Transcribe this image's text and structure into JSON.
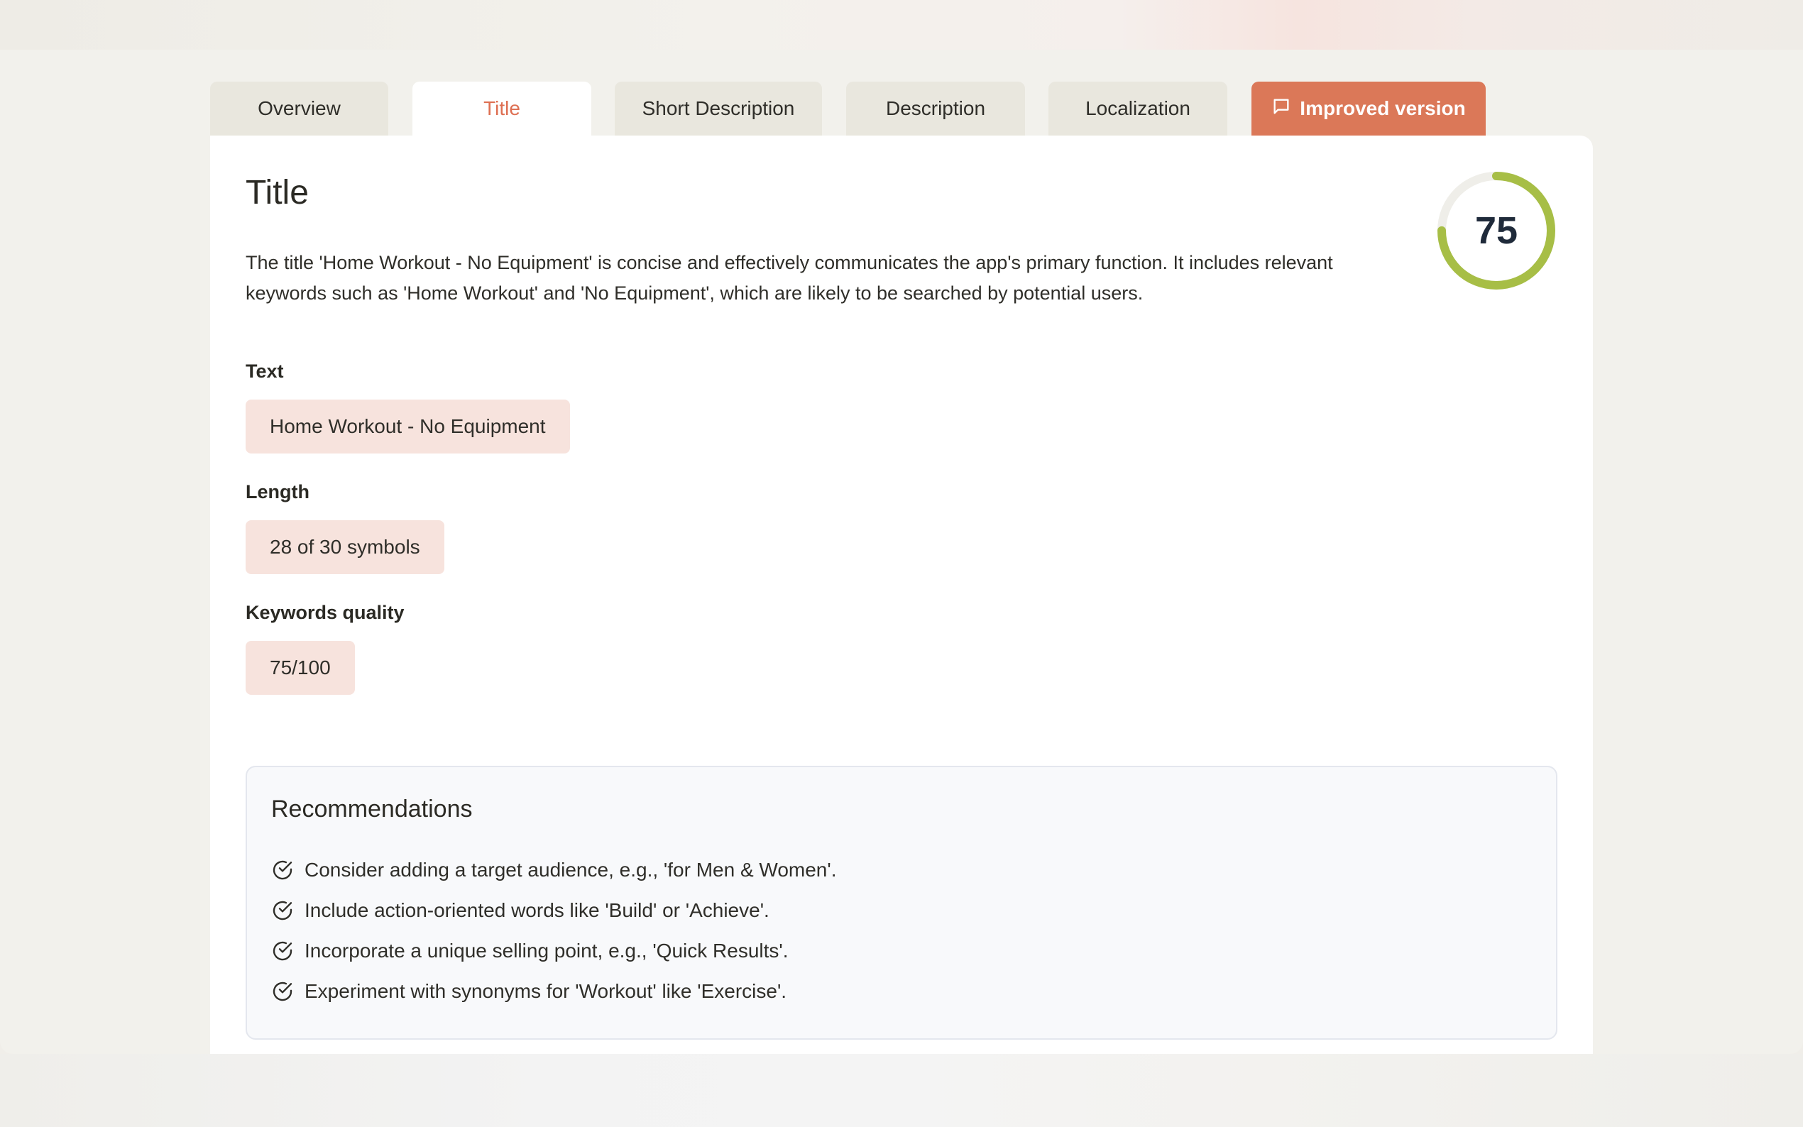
{
  "tabs": [
    {
      "label": "Overview",
      "active": false
    },
    {
      "label": "Title",
      "active": true
    },
    {
      "label": "Short Description",
      "active": false
    },
    {
      "label": "Description",
      "active": false
    },
    {
      "label": "Localization",
      "active": false
    },
    {
      "label": "Improved version",
      "icon": "chat-bubble-icon"
    }
  ],
  "section": {
    "heading": "Title",
    "summary": "The title 'Home Workout - No Equipment' is concise and effectively communicates the app's primary function. It includes relevant keywords such as 'Home Workout' and 'No Equipment', which are likely to be searched by potential users.",
    "score": {
      "value": "75",
      "max": 100
    }
  },
  "fields": {
    "text": {
      "label": "Text",
      "value": "Home Workout - No Equipment"
    },
    "length": {
      "label": "Length",
      "value": "28 of 30 symbols"
    },
    "keywords": {
      "label": "Keywords quality",
      "value": "75/100"
    }
  },
  "recommendations": {
    "title": "Recommendations",
    "icon": "check-circle-icon",
    "items": [
      "Consider adding a target audience, e.g., 'for Men & Women'.",
      "Include action-oriented words like 'Build' or 'Achieve'.",
      "Incorporate a unique selling point, e.g., 'Quick Results'.",
      "Experiment with synonyms for 'Workout' like 'Exercise'."
    ]
  },
  "colors": {
    "accent": "#db7858",
    "active_tab_text": "#de6f52",
    "score_ring": "#a7be46",
    "score_track": "#efeee9",
    "chip_bg": "#f7e3dd"
  }
}
